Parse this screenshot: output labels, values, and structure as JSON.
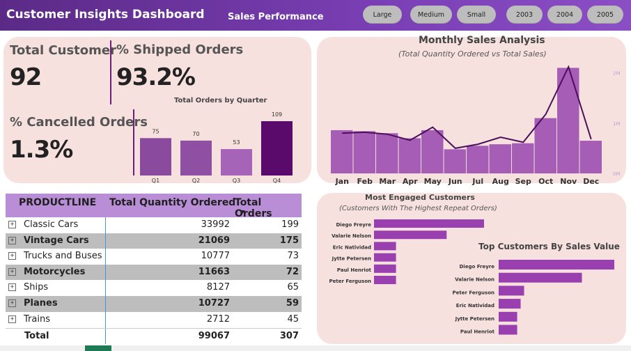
{
  "header": {
    "app_title": "Customer Insights Dashboard",
    "page_title": "Sales Performance",
    "slicers": [
      "Large",
      "Medium",
      "Small",
      "2003",
      "2004",
      "2005"
    ]
  },
  "kpis": {
    "total_customer_label": "Total Customer",
    "total_customer_value": "92",
    "shipped_label": "% Shipped Orders",
    "shipped_value": "93.2%",
    "cancelled_label": "% Cancelled Orders",
    "cancelled_value": "1.3%"
  },
  "quarter_chart": {
    "title": "Total Orders by Quarter",
    "categories": [
      "Q1",
      "Q2",
      "Q3",
      "Q4"
    ],
    "values": [
      75,
      70,
      53,
      109
    ],
    "colors": [
      "#8a4a9e",
      "#8f4fa3",
      "#a664b9",
      "#5a0a6a"
    ]
  },
  "monthly_chart": {
    "title": "Monthly Sales Analysis",
    "subtitle": "(Total Quantity Ordered vs Total Sales)",
    "months": [
      "Jan",
      "Feb",
      "Mar",
      "Apr",
      "May",
      "Jun",
      "Jul",
      "Aug",
      "Sep",
      "Oct",
      "Nov",
      "Dec"
    ],
    "y_ticks": [
      "2M",
      "1M",
      "0M"
    ]
  },
  "chart_data": [
    {
      "type": "bar",
      "title": "Total Orders by Quarter",
      "categories": [
        "Q1",
        "Q2",
        "Q3",
        "Q4"
      ],
      "values": [
        75,
        70,
        53,
        109
      ]
    },
    {
      "type": "bar",
      "title": "Monthly Sales Analysis",
      "subtitle": "(Total Quantity Ordered vs Total Sales)",
      "categories": [
        "Jan",
        "Feb",
        "Mar",
        "Apr",
        "May",
        "Jun",
        "Jul",
        "Aug",
        "Sep",
        "Oct",
        "Nov",
        "Dec"
      ],
      "series": [
        {
          "values": [
            0.86,
            0.84,
            0.8,
            0.7,
            0.86,
            0.48,
            0.55,
            0.58,
            0.6,
            1.1,
            2.1,
            0.65
          ]
        },
        {
          "values": [
            0.8,
            0.82,
            0.78,
            0.66,
            0.92,
            0.5,
            0.58,
            0.72,
            0.62,
            1.18,
            2.12,
            0.68
          ]
        }
      ],
      "y_ticks": [
        "2M",
        "1M",
        "0M"
      ],
      "ylim": [
        0,
        2.3
      ]
    },
    {
      "type": "bar",
      "title": "Most Engaged Customers",
      "subtitle": "(Customers With The Highest Repeat Orders)",
      "categories": [
        "Diego Freyre",
        "Valarie Nelson",
        "Eric Natividad",
        "Jytte Petersen",
        "Paul Henriot",
        "Peter Ferguson"
      ],
      "values": [
        10,
        6.6,
        2,
        2,
        2,
        2
      ]
    },
    {
      "type": "bar",
      "title": "Top Customers By Sales Value",
      "categories": [
        "Diego Freyre",
        "Valarie Nelson",
        "Peter Ferguson",
        "Eric Natividad",
        "Jytte Petersen",
        "Paul Henriot"
      ],
      "values": [
        10,
        7.2,
        2.2,
        1.9,
        1.6,
        1.6
      ]
    }
  ],
  "engaged_chart": {
    "title": "Most Engaged Customers",
    "subtitle": "(Customers With The Highest Repeat Orders)"
  },
  "top_sales_chart": {
    "title": "Top Customers By Sales Value"
  },
  "table": {
    "headers": [
      "PRODUCTLINE",
      "Total Quantity Ordered",
      "Total Orders"
    ],
    "rows": [
      {
        "name": "Classic Cars",
        "qty": "33992",
        "orders": "199"
      },
      {
        "name": "Vintage Cars",
        "qty": "21069",
        "orders": "175"
      },
      {
        "name": "Trucks and Buses",
        "qty": "10777",
        "orders": "73"
      },
      {
        "name": "Motorcycles",
        "qty": "11663",
        "orders": "72"
      },
      {
        "name": "Ships",
        "qty": "8127",
        "orders": "65"
      },
      {
        "name": "Planes",
        "qty": "10727",
        "orders": "59"
      },
      {
        "name": "Trains",
        "qty": "2712",
        "orders": "45"
      }
    ],
    "total": {
      "name": "Total",
      "qty": "99067",
      "orders": "307"
    },
    "expand_glyph": "+"
  },
  "colors": {
    "header_purple": "#6a35a0",
    "card_bg": "#f6e1de",
    "bar_purple": "#a55db5",
    "line_dark": "#4b0f5c",
    "hbar_purple": "#9a3fb0",
    "table_header": "#b98ed6"
  }
}
